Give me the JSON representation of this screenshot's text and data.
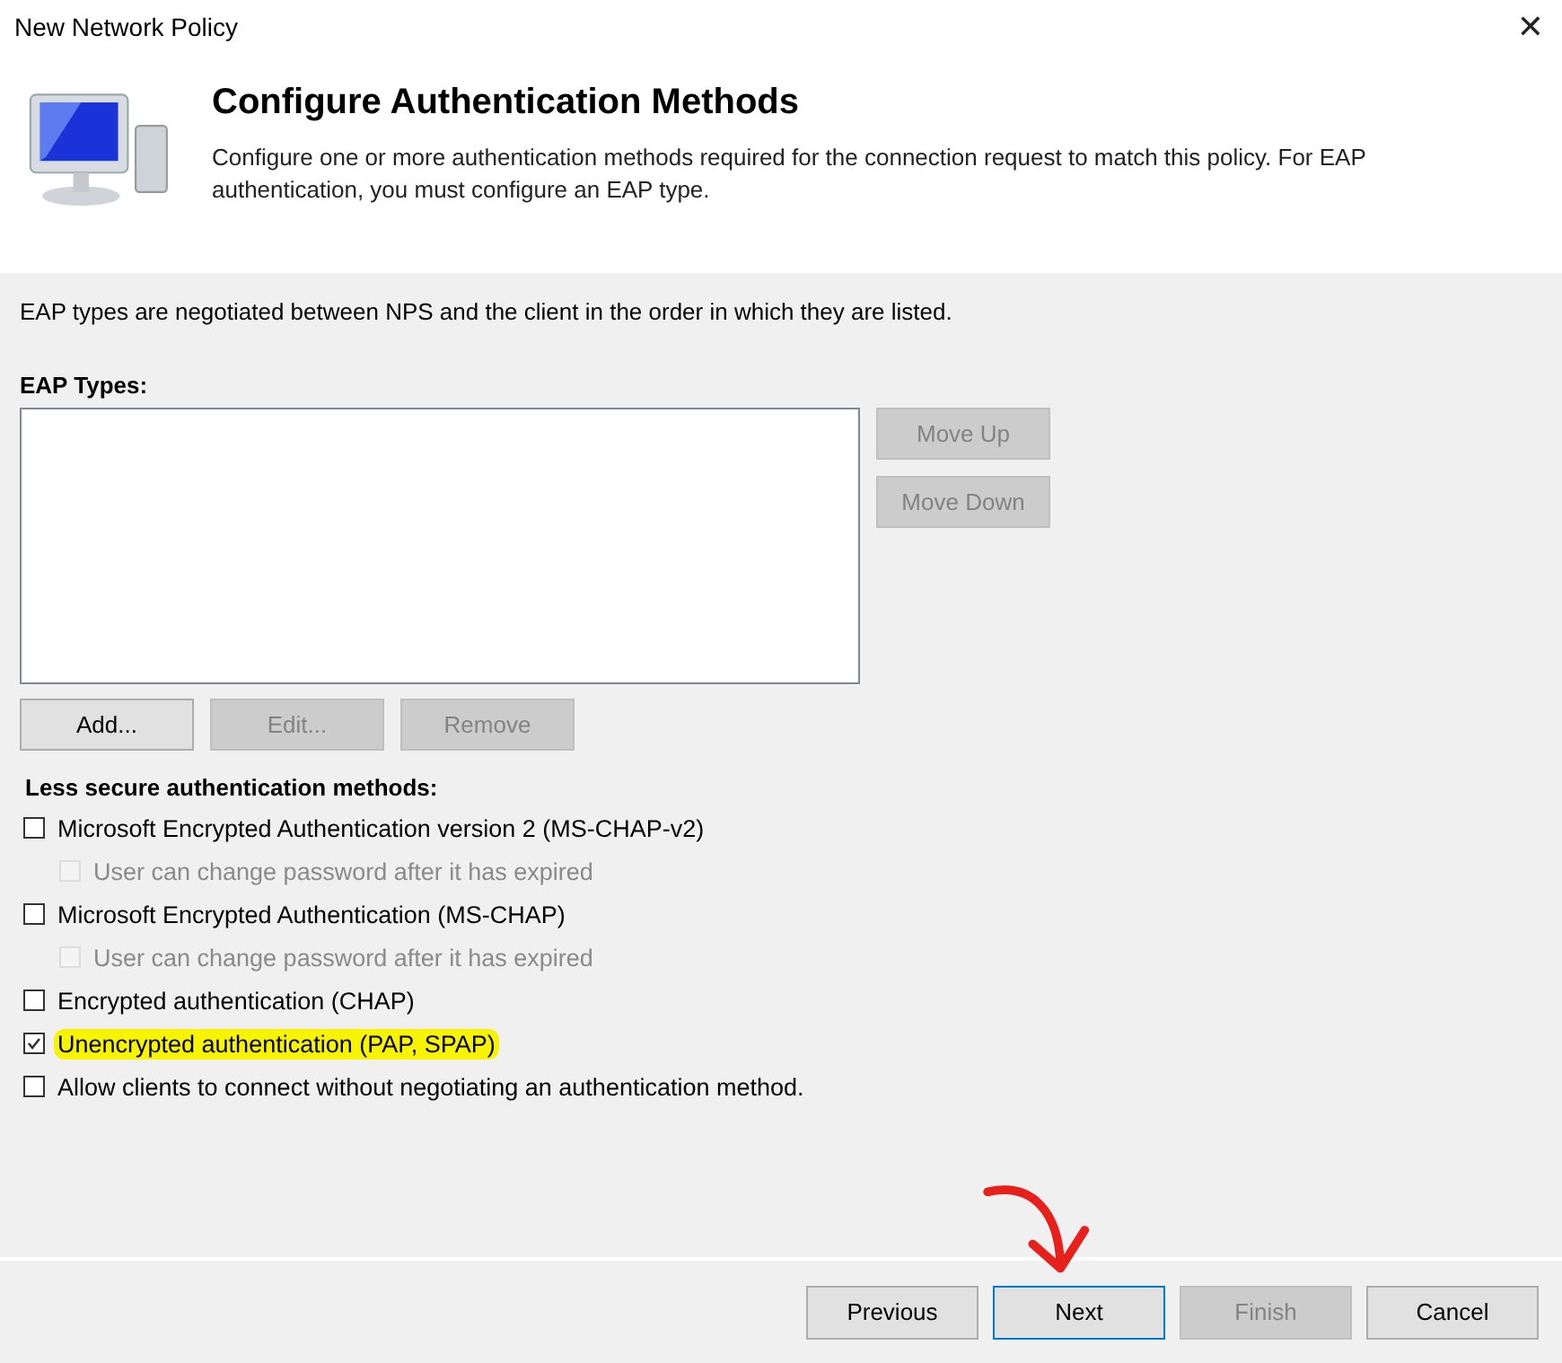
{
  "window": {
    "title": "New Network Policy",
    "close": "✕"
  },
  "header": {
    "title": "Configure Authentication Methods",
    "description": "Configure one or more authentication methods required for the connection request to match this policy. For EAP authentication, you must configure an EAP type."
  },
  "intro": "EAP types are negotiated between NPS and the client in the order in which they are listed.",
  "eap": {
    "label": "EAP Types:",
    "side_buttons": [
      {
        "label": "Move Up",
        "disabled": true
      },
      {
        "label": "Move Down",
        "disabled": true
      }
    ],
    "buttons": [
      {
        "label": "Add...",
        "disabled": false
      },
      {
        "label": "Edit...",
        "disabled": true
      },
      {
        "label": "Remove",
        "disabled": true
      }
    ]
  },
  "less_secure": {
    "label": "Less secure authentication methods:",
    "options": [
      {
        "label": "Microsoft Encrypted Authentication version 2 (MS-CHAP-v2)",
        "checked": false,
        "disabled": false,
        "highlighted": false,
        "children": [
          {
            "label": "User can change password after it has expired",
            "checked": false,
            "disabled": true,
            "highlighted": false
          }
        ]
      },
      {
        "label": "Microsoft Encrypted Authentication (MS-CHAP)",
        "checked": false,
        "disabled": false,
        "highlighted": false,
        "children": [
          {
            "label": "User can change password after it has expired",
            "checked": false,
            "disabled": true,
            "highlighted": false
          }
        ]
      },
      {
        "label": "Encrypted authentication (CHAP)",
        "checked": false,
        "disabled": false,
        "highlighted": false
      },
      {
        "label": "Unencrypted authentication (PAP, SPAP)",
        "checked": true,
        "disabled": false,
        "highlighted": true
      },
      {
        "label": "Allow clients to connect without negotiating an authentication method.",
        "checked": false,
        "disabled": false,
        "highlighted": false
      }
    ]
  },
  "footer_buttons": [
    {
      "label": "Previous",
      "disabled": false,
      "focused": false,
      "annotated": false
    },
    {
      "label": "Next",
      "disabled": false,
      "focused": true,
      "annotated": true
    },
    {
      "label": "Finish",
      "disabled": true,
      "focused": false,
      "annotated": false
    },
    {
      "label": "Cancel",
      "disabled": false,
      "focused": false,
      "annotated": false
    }
  ]
}
